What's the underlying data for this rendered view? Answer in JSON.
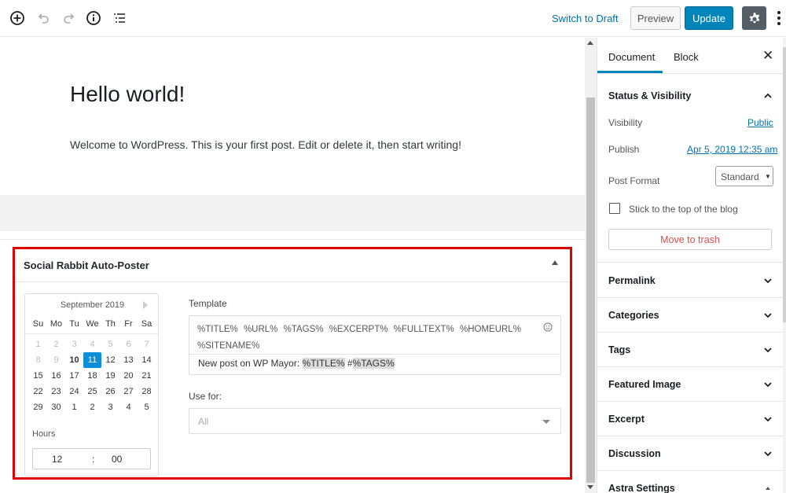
{
  "toolbar": {
    "icons": [
      "add-block-icon",
      "undo-icon",
      "redo-icon",
      "info-icon",
      "outline-icon"
    ],
    "switch_draft": "Switch to Draft",
    "preview": "Preview",
    "update": "Update"
  },
  "post": {
    "title": "Hello world!",
    "body": "Welcome to WordPress. This is your first post. Edit or delete it, then start writing!"
  },
  "metabox": {
    "title": "Social Rabbit Auto-Poster",
    "calendar": {
      "month": "September 2019",
      "dow": [
        "Su",
        "Mo",
        "Tu",
        "We",
        "Th",
        "Fr",
        "Sa"
      ],
      "days": [
        {
          "d": "1",
          "s": "dis"
        },
        {
          "d": "2",
          "s": "dis"
        },
        {
          "d": "3",
          "s": "dis"
        },
        {
          "d": "4",
          "s": "dis"
        },
        {
          "d": "5",
          "s": "dis"
        },
        {
          "d": "6",
          "s": "dis"
        },
        {
          "d": "7",
          "s": "dis"
        },
        {
          "d": "8",
          "s": "dis"
        },
        {
          "d": "9",
          "s": "dis"
        },
        {
          "d": "10",
          "s": "bold"
        },
        {
          "d": "11",
          "s": "sel"
        },
        {
          "d": "12",
          "s": ""
        },
        {
          "d": "13",
          "s": ""
        },
        {
          "d": "14",
          "s": ""
        },
        {
          "d": "15",
          "s": ""
        },
        {
          "d": "16",
          "s": ""
        },
        {
          "d": "17",
          "s": ""
        },
        {
          "d": "18",
          "s": ""
        },
        {
          "d": "19",
          "s": ""
        },
        {
          "d": "20",
          "s": ""
        },
        {
          "d": "21",
          "s": ""
        },
        {
          "d": "22",
          "s": ""
        },
        {
          "d": "23",
          "s": ""
        },
        {
          "d": "24",
          "s": ""
        },
        {
          "d": "25",
          "s": ""
        },
        {
          "d": "26",
          "s": ""
        },
        {
          "d": "27",
          "s": ""
        },
        {
          "d": "28",
          "s": ""
        },
        {
          "d": "29",
          "s": ""
        },
        {
          "d": "30",
          "s": ""
        },
        {
          "d": "1",
          "s": ""
        },
        {
          "d": "2",
          "s": ""
        },
        {
          "d": "3",
          "s": ""
        },
        {
          "d": "4",
          "s": ""
        },
        {
          "d": "5",
          "s": ""
        }
      ],
      "hours_label": "Hours",
      "hour": "12",
      "sep": ":",
      "minute": "00"
    },
    "template_label": "Template",
    "template_tags": "%TITLE% %URL% %TAGS% %EXCERPT% %FULLTEXT% %HOMEURL% %SITENAME%",
    "template_text_prefix": "New post on WP Mayor: ",
    "template_hl1": "%TITLE%",
    "template_mid": " #",
    "template_hl2": "%TAGS%",
    "use_for_label": "Use for:",
    "use_for_value": "All"
  },
  "sidebar": {
    "tab_document": "Document",
    "tab_block": "Block",
    "close": "✕",
    "status_title": "Status & Visibility",
    "visibility_label": "Visibility",
    "visibility_value": "Public",
    "publish_label": "Publish",
    "publish_value": "Apr 5, 2019 12:35 am",
    "post_format_label": "Post Format",
    "post_format_value": "Standard",
    "sticky_label": "Stick to the top of the blog",
    "trash": "Move to trash",
    "panels": [
      "Permalink",
      "Categories",
      "Tags",
      "Featured Image",
      "Excerpt",
      "Discussion",
      "Astra Settings"
    ]
  },
  "colors": {
    "accent": "#0085ba",
    "link": "#0073aa",
    "highlight_border": "#e10000",
    "trash": "#d94f4f"
  }
}
